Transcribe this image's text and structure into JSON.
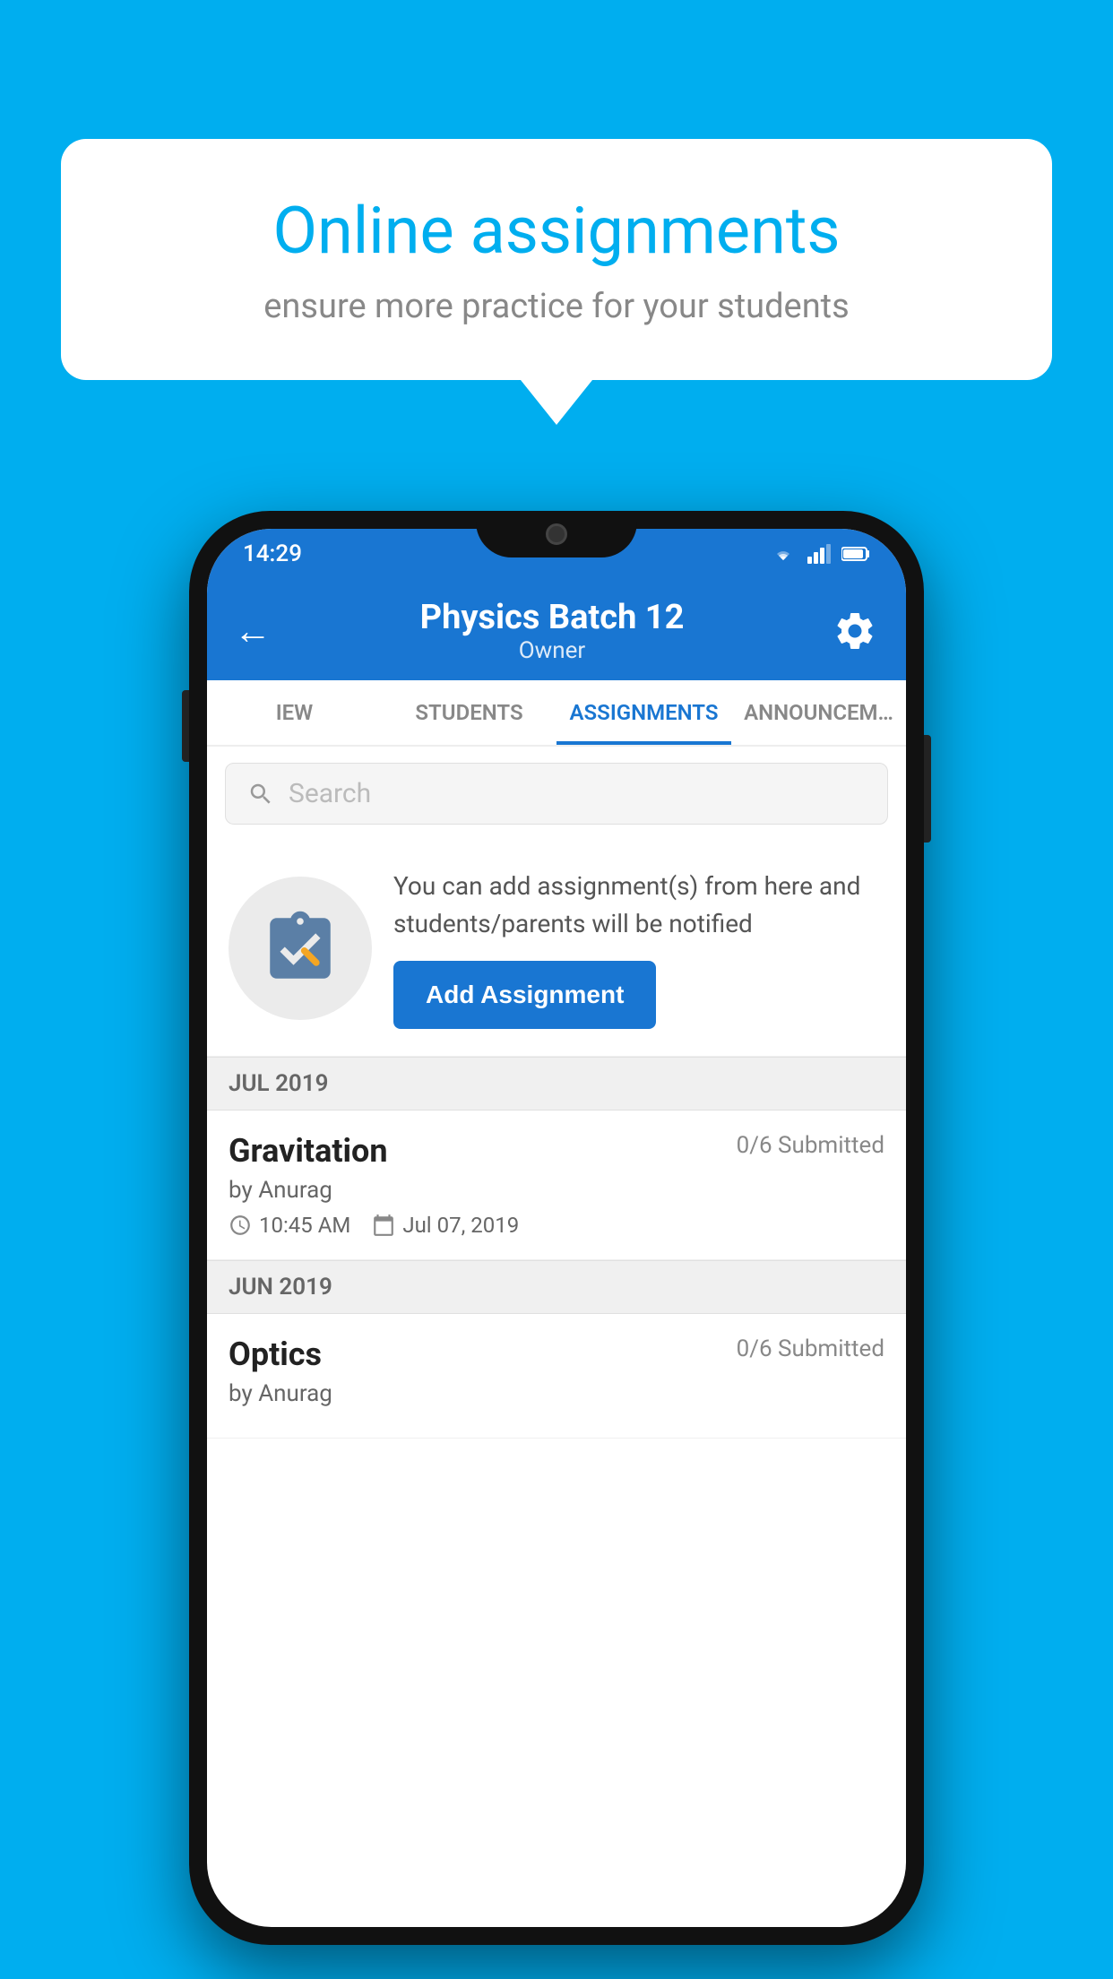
{
  "background_color": "#00AEEF",
  "speech_bubble": {
    "title": "Online assignments",
    "subtitle": "ensure more practice for your students"
  },
  "status_bar": {
    "time": "14:29",
    "icons": [
      "wifi",
      "signal",
      "battery"
    ]
  },
  "header": {
    "title": "Physics Batch 12",
    "subtitle": "Owner",
    "back_label": "←",
    "settings_label": "⚙"
  },
  "tabs": [
    {
      "label": "IEW",
      "active": false
    },
    {
      "label": "STUDENTS",
      "active": false
    },
    {
      "label": "ASSIGNMENTS",
      "active": true
    },
    {
      "label": "ANNOUNCEM…",
      "active": false
    }
  ],
  "search": {
    "placeholder": "Search"
  },
  "info_card": {
    "description": "You can add assignment(s) from here and students/parents will be notified",
    "button_label": "Add Assignment"
  },
  "sections": [
    {
      "month": "JUL 2019",
      "assignments": [
        {
          "name": "Gravitation",
          "submitted": "0/6 Submitted",
          "by": "by Anurag",
          "time": "10:45 AM",
          "date": "Jul 07, 2019"
        }
      ]
    },
    {
      "month": "JUN 2019",
      "assignments": [
        {
          "name": "Optics",
          "submitted": "0/6 Submitted",
          "by": "by Anurag",
          "time": "",
          "date": ""
        }
      ]
    }
  ]
}
